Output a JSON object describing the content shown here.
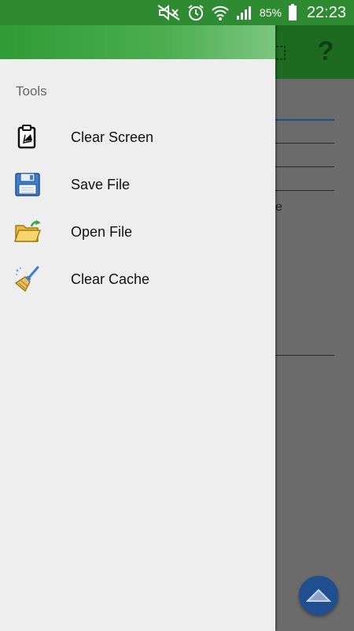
{
  "status_bar": {
    "battery_percent": "85%",
    "time": "22:23",
    "icons": [
      "mute-icon",
      "alarm-icon",
      "wifi-icon",
      "signal-icon",
      "battery-icon"
    ]
  },
  "background_app": {
    "toolbar_icons": [
      "grid-icon",
      "help-icon"
    ],
    "help_glyph": "?",
    "stray_text": "e",
    "fab_icon": "chevron-up-icon"
  },
  "drawer": {
    "section_title": "Tools",
    "items": [
      {
        "label": "Clear Screen",
        "icon": "clipboard-icon"
      },
      {
        "label": "Save File",
        "icon": "floppy-disk-icon"
      },
      {
        "label": "Open File",
        "icon": "open-folder-icon"
      },
      {
        "label": "Clear Cache",
        "icon": "broom-icon"
      }
    ]
  },
  "colors": {
    "status_bar": "#2e8b32",
    "drawer_header_start": "#2f9b34",
    "drawer_background": "#eeeeee",
    "fab": "#1f4f8f"
  }
}
